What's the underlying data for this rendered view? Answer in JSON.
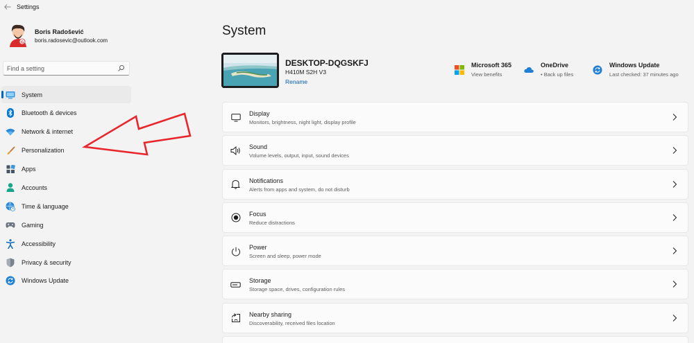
{
  "window": {
    "title": "Settings"
  },
  "profile": {
    "name": "Boris Radošević",
    "email": "boris.radosevic@outlook.com"
  },
  "search": {
    "placeholder": "Find a setting"
  },
  "nav": {
    "selected": "System",
    "items": [
      {
        "label": "System",
        "icon": "system-icon"
      },
      {
        "label": "Bluetooth & devices",
        "icon": "bluetooth-icon"
      },
      {
        "label": "Network & internet",
        "icon": "wifi-icon"
      },
      {
        "label": "Personalization",
        "icon": "brush-icon"
      },
      {
        "label": "Apps",
        "icon": "apps-icon"
      },
      {
        "label": "Accounts",
        "icon": "person-icon"
      },
      {
        "label": "Time & language",
        "icon": "globe-clock-icon"
      },
      {
        "label": "Gaming",
        "icon": "gamepad-icon"
      },
      {
        "label": "Accessibility",
        "icon": "accessibility-icon"
      },
      {
        "label": "Privacy & security",
        "icon": "shield-icon"
      },
      {
        "label": "Windows Update",
        "icon": "update-icon"
      }
    ]
  },
  "main": {
    "title": "System",
    "device": {
      "name": "DESKTOP-DQGSKFJ",
      "model": "H410M S2H V3",
      "rename": "Rename"
    },
    "quick_links": [
      {
        "title": "Microsoft 365",
        "subtitle": "View benefits",
        "icon": "microsoft-logo-icon"
      },
      {
        "title": "OneDrive",
        "subtitle": "• Back up files",
        "icon": "cloud-icon"
      },
      {
        "title": "Windows Update",
        "subtitle": "Last checked: 37 minutes ago",
        "icon": "update-icon"
      }
    ],
    "cards": [
      {
        "title": "Display",
        "subtitle": "Monitors, brightness, night light, display profile",
        "icon": "monitor-icon"
      },
      {
        "title": "Sound",
        "subtitle": "Volume levels, output, input, sound devices",
        "icon": "speaker-icon"
      },
      {
        "title": "Notifications",
        "subtitle": "Alerts from apps and system, do not disturb",
        "icon": "bell-icon"
      },
      {
        "title": "Focus",
        "subtitle": "Reduce distractions",
        "icon": "focus-icon"
      },
      {
        "title": "Power",
        "subtitle": "Screen and sleep, power mode",
        "icon": "power-icon"
      },
      {
        "title": "Storage",
        "subtitle": "Storage space, drives, configuration rules",
        "icon": "storage-icon"
      },
      {
        "title": "Nearby sharing",
        "subtitle": "Discoverability, received files location",
        "icon": "share-icon"
      }
    ]
  },
  "colors": {
    "accent": "#0067c0",
    "annotation_arrow": "#e8262b",
    "background": "#f3f3f3",
    "card": "#fbfbfb"
  }
}
